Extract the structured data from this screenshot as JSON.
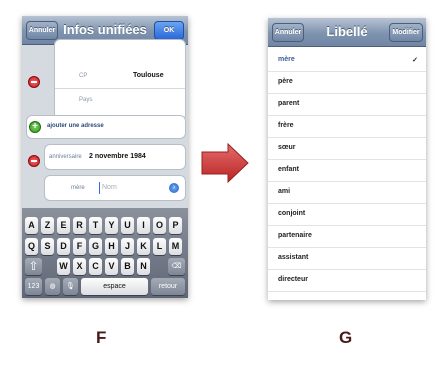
{
  "left_screen": {
    "nav": {
      "cancel": "Annuler",
      "title": "Infos unifiées",
      "ok": "OK"
    },
    "address": {
      "cp_label": "CP",
      "cp_value": "Toulouse",
      "country_label": "Pays"
    },
    "add_address": "ajouter une adresse",
    "birthday": {
      "label": "anniversaire",
      "value": "2 novembre 1984"
    },
    "related": {
      "label": "mère",
      "placeholder": "Nom"
    },
    "keyboard": {
      "row1": [
        "A",
        "Z",
        "E",
        "R",
        "T",
        "Y",
        "U",
        "I",
        "O",
        "P"
      ],
      "row2": [
        "Q",
        "S",
        "D",
        "F",
        "G",
        "H",
        "J",
        "K",
        "L",
        "M"
      ],
      "row3": [
        "W",
        "X",
        "C",
        "V",
        "B",
        "N"
      ],
      "num": "123",
      "space": "espace",
      "return": "retour"
    }
  },
  "right_screen": {
    "nav": {
      "cancel": "Annuler",
      "title": "Libellé",
      "edit": "Modifier"
    },
    "items": [
      "mère",
      "père",
      "parent",
      "frère",
      "sœur",
      "enfant",
      "ami",
      "conjoint",
      "partenaire",
      "assistant",
      "directeur"
    ],
    "checked_index": 0
  },
  "captions": {
    "left": "F",
    "right": "G"
  },
  "colors": {
    "arrow": "#cf3b3b",
    "nav_bar": "#7f93ae",
    "ok_button": "#2a68d8"
  }
}
